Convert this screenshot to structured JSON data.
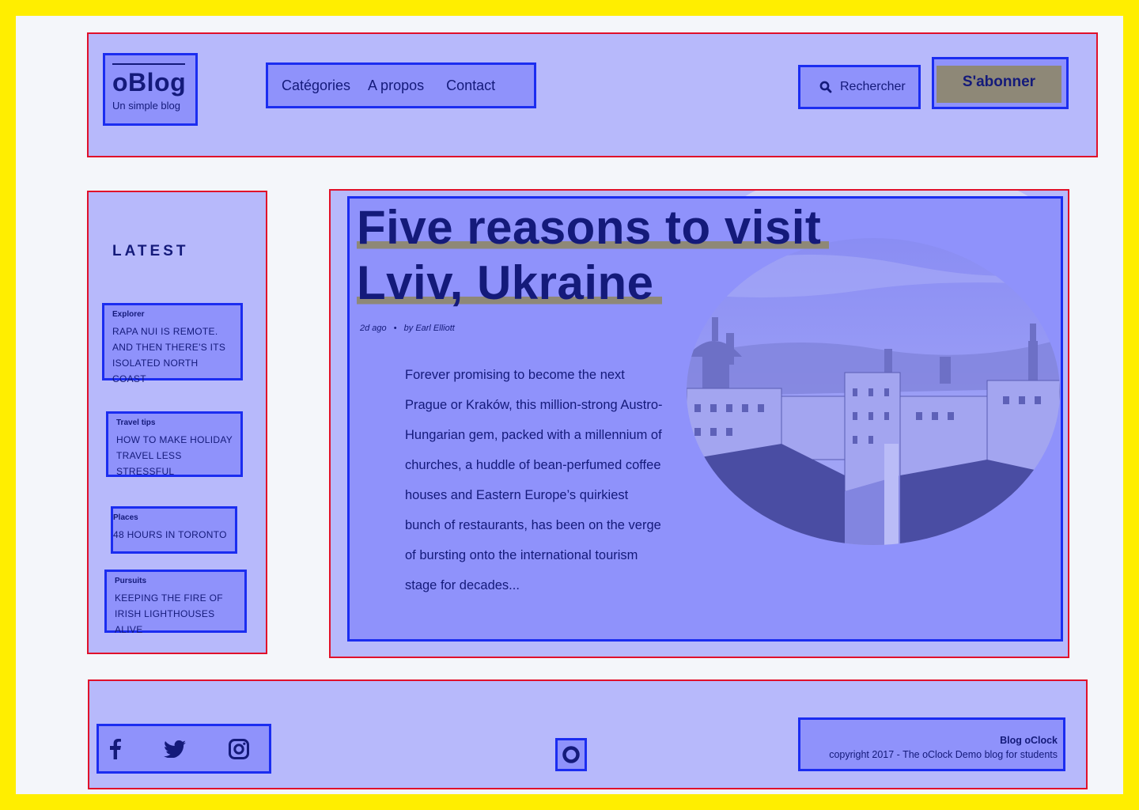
{
  "header": {
    "logo_title": "oBlog",
    "logo_subtitle": "Un simple blog",
    "nav": [
      "Catégories",
      "A propos",
      "Contact"
    ],
    "search_label": "Rechercher",
    "subscribe_label": "S'abonner"
  },
  "sidebar": {
    "title": "LATEST",
    "items": [
      {
        "category": "Explorer",
        "text": "Rapa Nui is remote. And then there's its isolated north coast"
      },
      {
        "category": "Travel tips",
        "text": "How to make holiday travel less stressful"
      },
      {
        "category": "Places",
        "text": "48 hours in Toronto"
      },
      {
        "category": "Pursuits",
        "text": "Keeping the fire of Irish lighthouses alive"
      }
    ]
  },
  "article": {
    "title_line1": "Five reasons to visit",
    "title_line2": "Lviv, Ukraine",
    "date": "2d ago",
    "author": "by Earl Elliott",
    "excerpt": "Forever promising to become the next Prague or Kraków, this million-strong Austro-Hungarian gem, packed with a millennium of churches, a huddle of bean-perfumed coffee houses and Eastern Europe’s quirkiest bunch of restaurants, has been on the verge of bursting onto the international tourism stage for decades..."
  },
  "footer": {
    "social_icons": [
      "facebook-icon",
      "twitter-icon",
      "instagram-icon"
    ],
    "brand": "Blog oClock",
    "copyright": "copyright 2017 - The oClock Demo blog for students"
  },
  "colors": {
    "page_border": "#ffee00",
    "zone_fill": "#b7b9fb",
    "box_fill": "#8f92fb",
    "zone_outline": "#e0102a",
    "box_outline": "#1b2df0",
    "ink": "#141a7a",
    "accent": "#8e8877"
  }
}
